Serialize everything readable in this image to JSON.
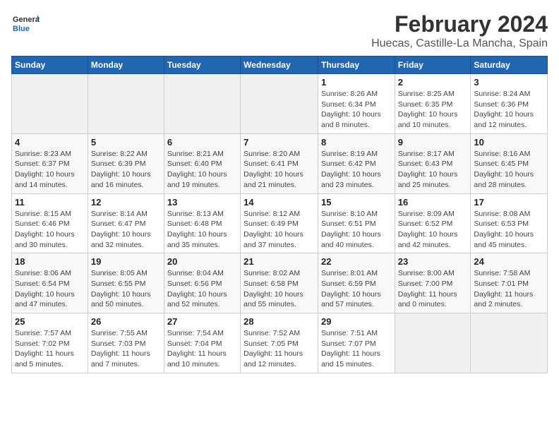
{
  "logo": {
    "general": "General",
    "blue": "Blue"
  },
  "title": "February 2024",
  "subtitle": "Huecas, Castille-La Mancha, Spain",
  "weekdays": [
    "Sunday",
    "Monday",
    "Tuesday",
    "Wednesday",
    "Thursday",
    "Friday",
    "Saturday"
  ],
  "weeks": [
    [
      {
        "day": "",
        "info": ""
      },
      {
        "day": "",
        "info": ""
      },
      {
        "day": "",
        "info": ""
      },
      {
        "day": "",
        "info": ""
      },
      {
        "day": "1",
        "info": "Sunrise: 8:26 AM\nSunset: 6:34 PM\nDaylight: 10 hours\nand 8 minutes."
      },
      {
        "day": "2",
        "info": "Sunrise: 8:25 AM\nSunset: 6:35 PM\nDaylight: 10 hours\nand 10 minutes."
      },
      {
        "day": "3",
        "info": "Sunrise: 8:24 AM\nSunset: 6:36 PM\nDaylight: 10 hours\nand 12 minutes."
      }
    ],
    [
      {
        "day": "4",
        "info": "Sunrise: 8:23 AM\nSunset: 6:37 PM\nDaylight: 10 hours\nand 14 minutes."
      },
      {
        "day": "5",
        "info": "Sunrise: 8:22 AM\nSunset: 6:39 PM\nDaylight: 10 hours\nand 16 minutes."
      },
      {
        "day": "6",
        "info": "Sunrise: 8:21 AM\nSunset: 6:40 PM\nDaylight: 10 hours\nand 19 minutes."
      },
      {
        "day": "7",
        "info": "Sunrise: 8:20 AM\nSunset: 6:41 PM\nDaylight: 10 hours\nand 21 minutes."
      },
      {
        "day": "8",
        "info": "Sunrise: 8:19 AM\nSunset: 6:42 PM\nDaylight: 10 hours\nand 23 minutes."
      },
      {
        "day": "9",
        "info": "Sunrise: 8:17 AM\nSunset: 6:43 PM\nDaylight: 10 hours\nand 25 minutes."
      },
      {
        "day": "10",
        "info": "Sunrise: 8:16 AM\nSunset: 6:45 PM\nDaylight: 10 hours\nand 28 minutes."
      }
    ],
    [
      {
        "day": "11",
        "info": "Sunrise: 8:15 AM\nSunset: 6:46 PM\nDaylight: 10 hours\nand 30 minutes."
      },
      {
        "day": "12",
        "info": "Sunrise: 8:14 AM\nSunset: 6:47 PM\nDaylight: 10 hours\nand 32 minutes."
      },
      {
        "day": "13",
        "info": "Sunrise: 8:13 AM\nSunset: 6:48 PM\nDaylight: 10 hours\nand 35 minutes."
      },
      {
        "day": "14",
        "info": "Sunrise: 8:12 AM\nSunset: 6:49 PM\nDaylight: 10 hours\nand 37 minutes."
      },
      {
        "day": "15",
        "info": "Sunrise: 8:10 AM\nSunset: 6:51 PM\nDaylight: 10 hours\nand 40 minutes."
      },
      {
        "day": "16",
        "info": "Sunrise: 8:09 AM\nSunset: 6:52 PM\nDaylight: 10 hours\nand 42 minutes."
      },
      {
        "day": "17",
        "info": "Sunrise: 8:08 AM\nSunset: 6:53 PM\nDaylight: 10 hours\nand 45 minutes."
      }
    ],
    [
      {
        "day": "18",
        "info": "Sunrise: 8:06 AM\nSunset: 6:54 PM\nDaylight: 10 hours\nand 47 minutes."
      },
      {
        "day": "19",
        "info": "Sunrise: 8:05 AM\nSunset: 6:55 PM\nDaylight: 10 hours\nand 50 minutes."
      },
      {
        "day": "20",
        "info": "Sunrise: 8:04 AM\nSunset: 6:56 PM\nDaylight: 10 hours\nand 52 minutes."
      },
      {
        "day": "21",
        "info": "Sunrise: 8:02 AM\nSunset: 6:58 PM\nDaylight: 10 hours\nand 55 minutes."
      },
      {
        "day": "22",
        "info": "Sunrise: 8:01 AM\nSunset: 6:59 PM\nDaylight: 10 hours\nand 57 minutes."
      },
      {
        "day": "23",
        "info": "Sunrise: 8:00 AM\nSunset: 7:00 PM\nDaylight: 11 hours\nand 0 minutes."
      },
      {
        "day": "24",
        "info": "Sunrise: 7:58 AM\nSunset: 7:01 PM\nDaylight: 11 hours\nand 2 minutes."
      }
    ],
    [
      {
        "day": "25",
        "info": "Sunrise: 7:57 AM\nSunset: 7:02 PM\nDaylight: 11 hours\nand 5 minutes."
      },
      {
        "day": "26",
        "info": "Sunrise: 7:55 AM\nSunset: 7:03 PM\nDaylight: 11 hours\nand 7 minutes."
      },
      {
        "day": "27",
        "info": "Sunrise: 7:54 AM\nSunset: 7:04 PM\nDaylight: 11 hours\nand 10 minutes."
      },
      {
        "day": "28",
        "info": "Sunrise: 7:52 AM\nSunset: 7:05 PM\nDaylight: 11 hours\nand 12 minutes."
      },
      {
        "day": "29",
        "info": "Sunrise: 7:51 AM\nSunset: 7:07 PM\nDaylight: 11 hours\nand 15 minutes."
      },
      {
        "day": "",
        "info": ""
      },
      {
        "day": "",
        "info": ""
      }
    ]
  ]
}
